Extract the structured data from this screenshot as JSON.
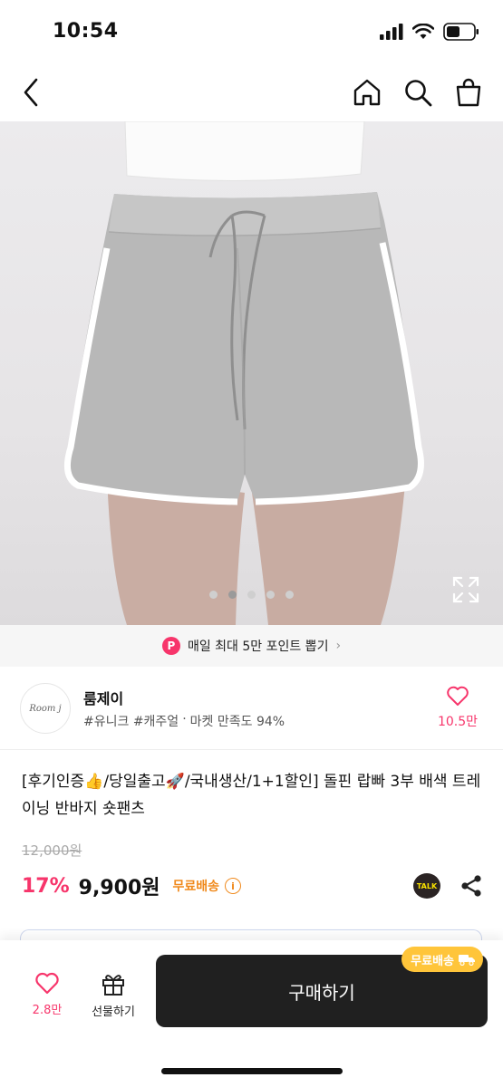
{
  "status_bar": {
    "time": "10:54"
  },
  "nav": {
    "back_icon": "chevron-left-icon",
    "home_icon": "home-icon",
    "search_icon": "search-icon",
    "cart_icon": "shopping-bag-icon"
  },
  "gallery": {
    "total_images": 5,
    "active_index": 1,
    "expand_icon": "expand-icon"
  },
  "points_banner": {
    "badge": "P",
    "text": "매일 최대 5만 포인트 뽑기",
    "chevron": "›"
  },
  "store": {
    "logo_text": "Room j",
    "name": "룸제이",
    "tags": "#유니크 #캐주얼",
    "separator": "·",
    "satisfaction": "마켓 만족도 94%",
    "like_count": "10.5만"
  },
  "product": {
    "title": "[후기인증👍/당일출고🚀/국내생산/1+1할인] 돌핀 랍빠 3부 배색 트레이닝 반바지 숏팬츠",
    "original_price": "12,000원",
    "discount": "17%",
    "sale_price": "9,900원",
    "shipping": "무료배송",
    "info_symbol": "i",
    "talk_label": "TALK"
  },
  "bottom_bar": {
    "like_count": "2.8만",
    "gift_label": "선물하기",
    "buy_label": "구매하기",
    "free_shipping_badge": "무료배송"
  },
  "colors": {
    "accent_pink": "#f7356b",
    "shipping_orange": "#f08a1d",
    "buy_button": "#202020",
    "badge_yellow": "#ffc53a"
  }
}
